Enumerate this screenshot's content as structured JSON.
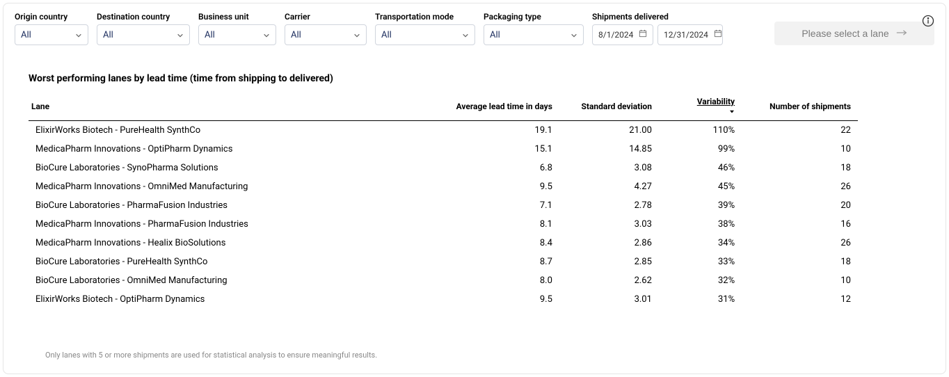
{
  "filters": {
    "origin": {
      "label": "Origin country",
      "value": "All"
    },
    "destination": {
      "label": "Destination country",
      "value": "All"
    },
    "businessUnit": {
      "label": "Business unit",
      "value": "All"
    },
    "carrier": {
      "label": "Carrier",
      "value": "All"
    },
    "transportMode": {
      "label": "Transportation mode",
      "value": "All"
    },
    "packaging": {
      "label": "Packaging type",
      "value": "All"
    },
    "shipments": {
      "label": "Shipments delivered",
      "from": "8/1/2024",
      "to": "12/31/2024"
    }
  },
  "laneButton": {
    "label": "Please select a lane"
  },
  "table": {
    "title": "Worst performing lanes by lead time (time from shipping to delivered)",
    "headers": {
      "lane": "Lane",
      "leadTime": "Average lead time in days",
      "stdDev": "Standard deviation",
      "variability": "Variability",
      "shipments": "Number of shipments"
    },
    "rows": [
      {
        "lane": "ElixirWorks Biotech - PureHealth SynthCo",
        "lead": "19.1",
        "std": "21.00",
        "var": "110%",
        "ship": "22"
      },
      {
        "lane": "MedicaPharm Innovations - OptiPharm Dynamics",
        "lead": "15.1",
        "std": "14.85",
        "var": "99%",
        "ship": "10"
      },
      {
        "lane": "BioCure Laboratories - SynoPharma Solutions",
        "lead": "6.8",
        "std": "3.08",
        "var": "46%",
        "ship": "18"
      },
      {
        "lane": "MedicaPharm Innovations - OmniMed Manufacturing",
        "lead": "9.5",
        "std": "4.27",
        "var": "45%",
        "ship": "26"
      },
      {
        "lane": "BioCure Laboratories - PharmaFusion Industries",
        "lead": "7.1",
        "std": "2.78",
        "var": "39%",
        "ship": "20"
      },
      {
        "lane": "MedicaPharm Innovations - PharmaFusion Industries",
        "lead": "8.1",
        "std": "3.03",
        "var": "38%",
        "ship": "16"
      },
      {
        "lane": "MedicaPharm Innovations - Healix BioSolutions",
        "lead": "8.4",
        "std": "2.86",
        "var": "34%",
        "ship": "26"
      },
      {
        "lane": "BioCure Laboratories - PureHealth SynthCo",
        "lead": "8.7",
        "std": "2.85",
        "var": "33%",
        "ship": "18"
      },
      {
        "lane": "BioCure Laboratories - OmniMed Manufacturing",
        "lead": "8.0",
        "std": "2.62",
        "var": "32%",
        "ship": "10"
      },
      {
        "lane": "ElixirWorks Biotech - OptiPharm Dynamics",
        "lead": "9.5",
        "std": "3.01",
        "var": "31%",
        "ship": "12"
      }
    ],
    "footnote": "Only lanes with 5 or more shipments are used for statistical analysis to ensure meaningful results."
  }
}
